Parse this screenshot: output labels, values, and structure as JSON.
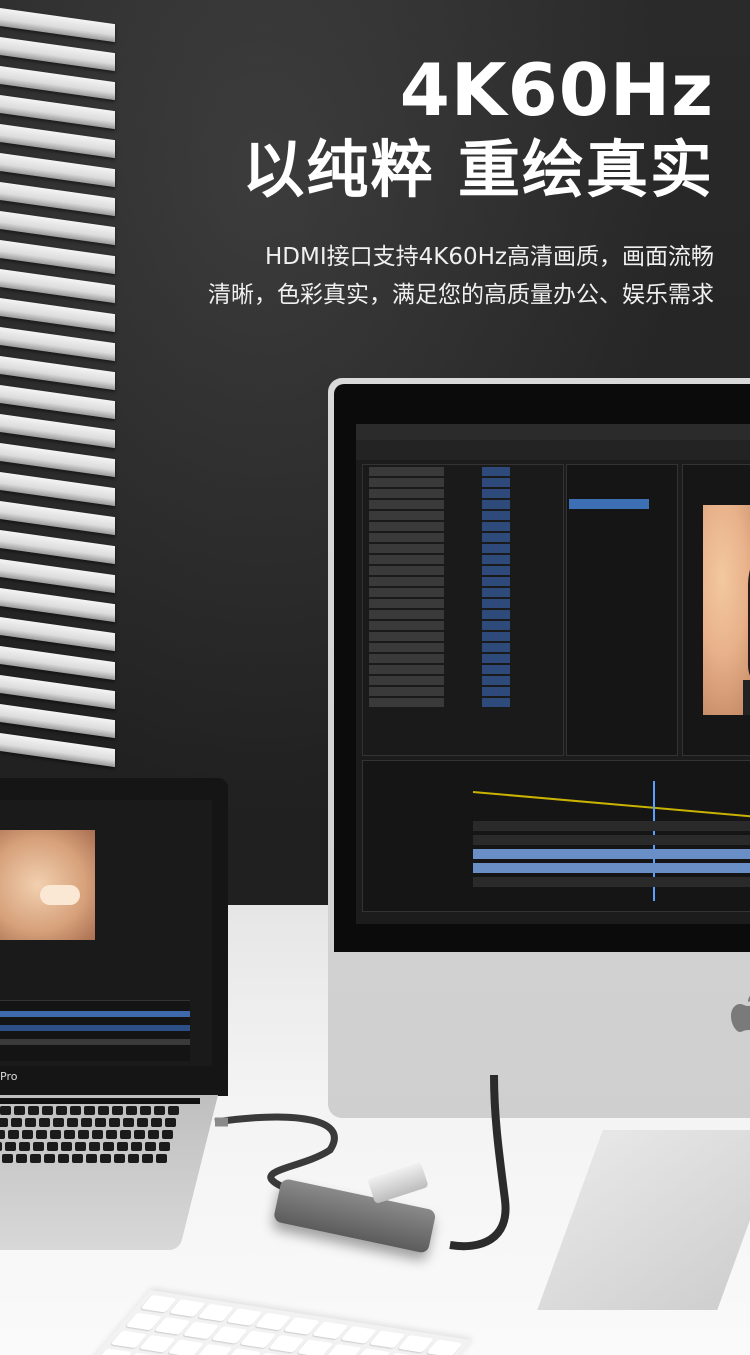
{
  "headline": {
    "line1": "4K60Hz",
    "line2": "以纯粹 重绘真实"
  },
  "description": {
    "line1": "HDMI接口支持4K60Hz高清画质，画面流畅",
    "line2": "清晰，色彩真实，满足您的高质量办公、娱乐需求"
  },
  "laptop": {
    "model_partial": "Pro"
  },
  "colors": {
    "background": "#232323",
    "text": "#ffffff",
    "desk": "#f3f3f3"
  },
  "icons": [
    "apple-logo-icon",
    "usb-hub",
    "hdmi-cable",
    "usb-drive"
  ]
}
